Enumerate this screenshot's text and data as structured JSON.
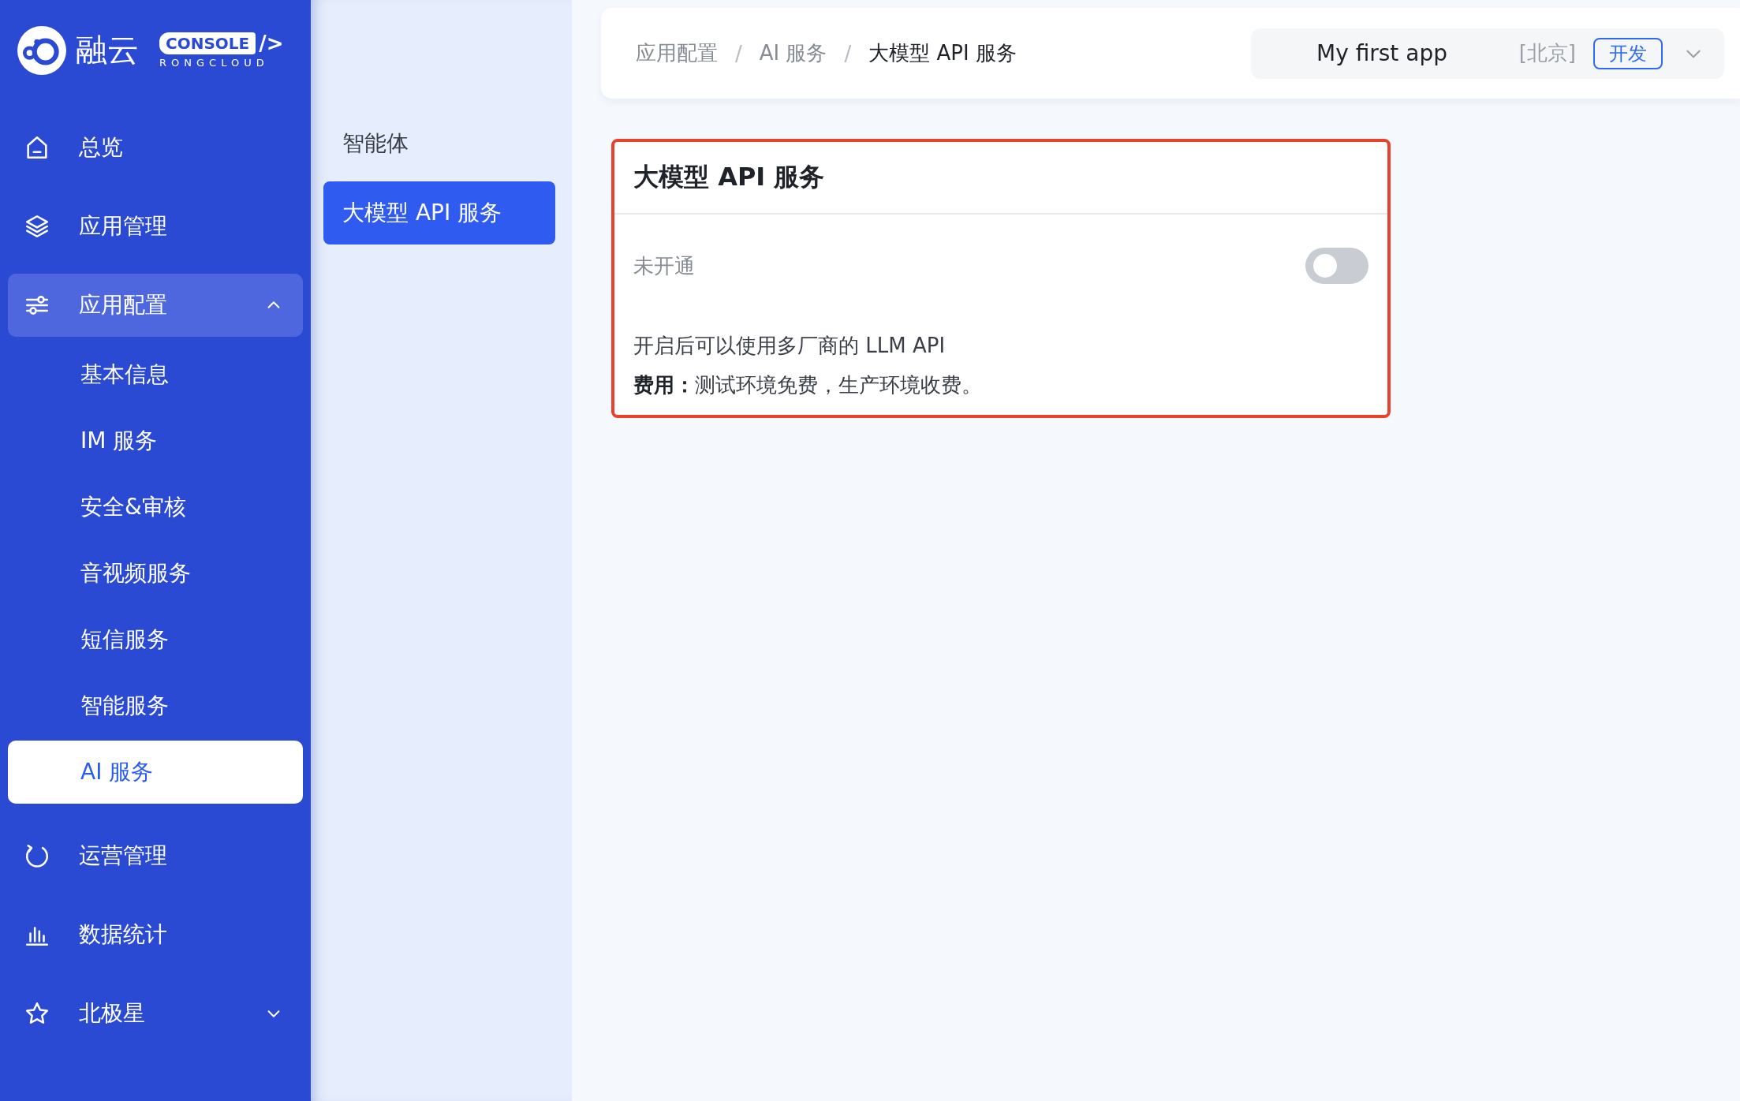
{
  "logo": {
    "name": "融云",
    "badge": "CONSOLE",
    "suffix": "/>",
    "subtitle": "RONGCLOUD"
  },
  "sidebar": {
    "items": [
      {
        "label": "总览",
        "selected": false
      },
      {
        "label": "应用管理",
        "selected": false
      },
      {
        "label": "应用配置",
        "selected": false,
        "expanded": true,
        "children": [
          {
            "label": "基本信息",
            "selected": false
          },
          {
            "label": "IM 服务",
            "selected": false
          },
          {
            "label": "安全&审核",
            "selected": false
          },
          {
            "label": "音视频服务",
            "selected": false
          },
          {
            "label": "短信服务",
            "selected": false
          },
          {
            "label": "智能服务",
            "selected": false
          },
          {
            "label": "AI 服务",
            "selected": true
          }
        ]
      },
      {
        "label": "运营管理",
        "selected": false
      },
      {
        "label": "数据统计",
        "selected": false
      },
      {
        "label": "北极星",
        "selected": false,
        "expanded": false
      }
    ]
  },
  "submenu": [
    {
      "label": "智能体",
      "selected": false
    },
    {
      "label": "大模型 API 服务",
      "selected": true
    }
  ],
  "breadcrumb": [
    {
      "kind": "link",
      "label": "应用配置"
    },
    {
      "kind": "separator",
      "label": "/"
    },
    {
      "kind": "link",
      "label": "AI 服务"
    },
    {
      "kind": "separator",
      "label": "/"
    },
    {
      "kind": "current",
      "label": "大模型 API 服务"
    }
  ],
  "app_selector": {
    "name": "My first app",
    "region": "[北京]",
    "env": "开发"
  },
  "card": {
    "title": "大模型 API 服务",
    "status": "未开通",
    "on": false,
    "description": "开启后可以使用多厂商的 LLM API",
    "fee": "**费用：**测试环境免费，生产环境收费。"
  }
}
